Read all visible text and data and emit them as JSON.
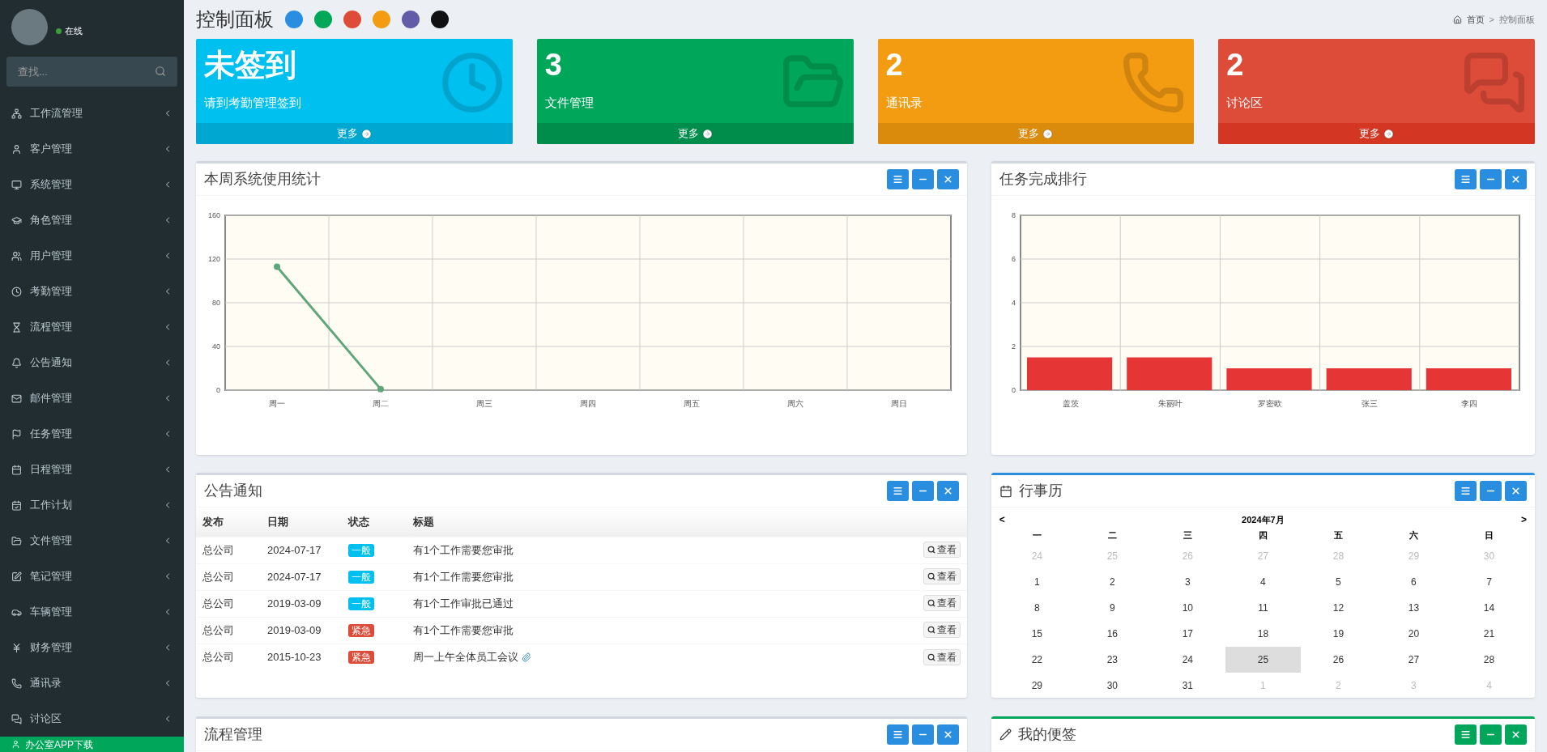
{
  "sidebar": {
    "user": {
      "status": "在线",
      "online": true
    },
    "search": {
      "placeholder": "查找..."
    },
    "items": [
      {
        "label": "工作流管理"
      },
      {
        "label": "客户管理"
      },
      {
        "label": "系统管理"
      },
      {
        "label": "角色管理"
      },
      {
        "label": "用户管理"
      },
      {
        "label": "考勤管理"
      },
      {
        "label": "流程管理"
      },
      {
        "label": "公告通知"
      },
      {
        "label": "邮件管理"
      },
      {
        "label": "任务管理"
      },
      {
        "label": "日程管理"
      },
      {
        "label": "工作计划"
      },
      {
        "label": "文件管理"
      },
      {
        "label": "笔记管理"
      },
      {
        "label": "车辆管理"
      },
      {
        "label": "财务管理"
      },
      {
        "label": "通讯录"
      },
      {
        "label": "讨论区"
      }
    ],
    "download": {
      "label": "办公室APP下载"
    }
  },
  "header": {
    "title": "控制面板",
    "themes": [
      {
        "color": "#2a8ee0"
      },
      {
        "color": "#00a65a"
      },
      {
        "color": "#dd4b39"
      },
      {
        "color": "#f39c12"
      },
      {
        "color": "#605ca8"
      },
      {
        "color": "#111111"
      }
    ],
    "breadcrumb": {
      "items": [
        "首页",
        "控制面板"
      ],
      "separator": ">"
    }
  },
  "cards": [
    {
      "value": "未签到",
      "label": "请到考勤管理签到",
      "more": "更多",
      "kind": "aqua"
    },
    {
      "value": "3",
      "label": "文件管理",
      "more": "更多",
      "kind": "green"
    },
    {
      "value": "2",
      "label": "通讯录",
      "more": "更多",
      "kind": "yellow"
    },
    {
      "value": "2",
      "label": "讨论区",
      "more": "更多",
      "kind": "red"
    }
  ],
  "usage_panel": {
    "title": "本周系统使用统计",
    "chart_data": {
      "type": "line",
      "categories": [
        "周一",
        "周二",
        "周三",
        "周四",
        "周五",
        "周六",
        "周日"
      ],
      "ylim": [
        0,
        160
      ],
      "yticks": [
        0,
        40,
        80,
        120,
        160
      ],
      "grid": true,
      "series": [
        {
          "color": "#5fa67a",
          "marker": true,
          "values": [
            113,
            1,
            null,
            null,
            null,
            null,
            null
          ]
        }
      ]
    }
  },
  "ranking_panel": {
    "title": "任务完成排行",
    "chart_data": {
      "type": "bar",
      "categories": [
        "盖茨",
        "朱丽叶",
        "罗密欧",
        "张三",
        "李四"
      ],
      "ylim": [
        0,
        8
      ],
      "yticks": [
        0,
        2,
        4,
        6,
        8
      ],
      "grid": true,
      "series": [
        {
          "color": "#e53535",
          "values": [
            1.5,
            1.5,
            1,
            1,
            1
          ]
        }
      ]
    }
  },
  "notice_panel": {
    "title": "公告通知",
    "columns": [
      "发布",
      "日期",
      "状态",
      "标题"
    ],
    "rows": [
      {
        "publisher": "总公司",
        "date": "2024-07-17",
        "status": "一般",
        "kind": "normal",
        "title": "有1个工作需要您审批",
        "attachment": false,
        "action": "查看"
      },
      {
        "publisher": "总公司",
        "date": "2024-07-17",
        "status": "一般",
        "kind": "normal",
        "title": "有1个工作需要您审批",
        "attachment": false,
        "action": "查看"
      },
      {
        "publisher": "总公司",
        "date": "2019-03-09",
        "status": "一般",
        "kind": "normal",
        "title": "有1个工作审批已通过",
        "attachment": false,
        "action": "查看"
      },
      {
        "publisher": "总公司",
        "date": "2019-03-09",
        "status": "紧急",
        "kind": "urgent",
        "title": "有1个工作需要您审批",
        "attachment": false,
        "action": "查看"
      },
      {
        "publisher": "总公司",
        "date": "2015-10-23",
        "status": "紧急",
        "kind": "urgent",
        "title": "周一上午全体员工会议",
        "attachment": true,
        "action": "查看"
      }
    ]
  },
  "calendar_panel": {
    "title": "行事历",
    "kind": "primary",
    "prev": "<",
    "month": "2024年7月",
    "next": ">",
    "weekdays": [
      "一",
      "二",
      "三",
      "四",
      "五",
      "六",
      "日"
    ],
    "weeks": [
      [
        {
          "day": "24",
          "current": false,
          "selected": false
        },
        {
          "day": "25",
          "current": false,
          "selected": false
        },
        {
          "day": "26",
          "current": false,
          "selected": false
        },
        {
          "day": "27",
          "current": false,
          "selected": false
        },
        {
          "day": "28",
          "current": false,
          "selected": false
        },
        {
          "day": "29",
          "current": false,
          "selected": false
        },
        {
          "day": "30",
          "current": false,
          "selected": false
        }
      ],
      [
        {
          "day": "1",
          "current": true,
          "selected": false
        },
        {
          "day": "2",
          "current": true,
          "selected": false
        },
        {
          "day": "3",
          "current": true,
          "selected": false
        },
        {
          "day": "4",
          "current": true,
          "selected": false
        },
        {
          "day": "5",
          "current": true,
          "selected": false
        },
        {
          "day": "6",
          "current": true,
          "selected": false
        },
        {
          "day": "7",
          "current": true,
          "selected": false
        }
      ],
      [
        {
          "day": "8",
          "current": true,
          "selected": false
        },
        {
          "day": "9",
          "current": true,
          "selected": false
        },
        {
          "day": "10",
          "current": true,
          "selected": false
        },
        {
          "day": "11",
          "current": true,
          "selected": false
        },
        {
          "day": "12",
          "current": true,
          "selected": false
        },
        {
          "day": "13",
          "current": true,
          "selected": false
        },
        {
          "day": "14",
          "current": true,
          "selected": false
        }
      ],
      [
        {
          "day": "15",
          "current": true,
          "selected": false
        },
        {
          "day": "16",
          "current": true,
          "selected": false
        },
        {
          "day": "17",
          "current": true,
          "selected": false
        },
        {
          "day": "18",
          "current": true,
          "selected": false
        },
        {
          "day": "19",
          "current": true,
          "selected": false
        },
        {
          "day": "20",
          "current": true,
          "selected": false
        },
        {
          "day": "21",
          "current": true,
          "selected": false
        }
      ],
      [
        {
          "day": "22",
          "current": true,
          "selected": false
        },
        {
          "day": "23",
          "current": true,
          "selected": false
        },
        {
          "day": "24",
          "current": true,
          "selected": false
        },
        {
          "day": "25",
          "current": true,
          "selected": true
        },
        {
          "day": "26",
          "current": true,
          "selected": false
        },
        {
          "day": "27",
          "current": true,
          "selected": false
        },
        {
          "day": "28",
          "current": true,
          "selected": false
        }
      ],
      [
        {
          "day": "29",
          "current": true,
          "selected": false
        },
        {
          "day": "30",
          "current": true,
          "selected": false
        },
        {
          "day": "31",
          "current": true,
          "selected": false
        },
        {
          "day": "1",
          "current": false,
          "selected": false
        },
        {
          "day": "2",
          "current": false,
          "selected": false
        },
        {
          "day": "3",
          "current": false,
          "selected": false
        },
        {
          "day": "4",
          "current": false,
          "selected": false
        }
      ]
    ]
  },
  "process_panel": {
    "title": "流程管理"
  },
  "notes_panel": {
    "title": "我的便签",
    "kind": "success"
  }
}
